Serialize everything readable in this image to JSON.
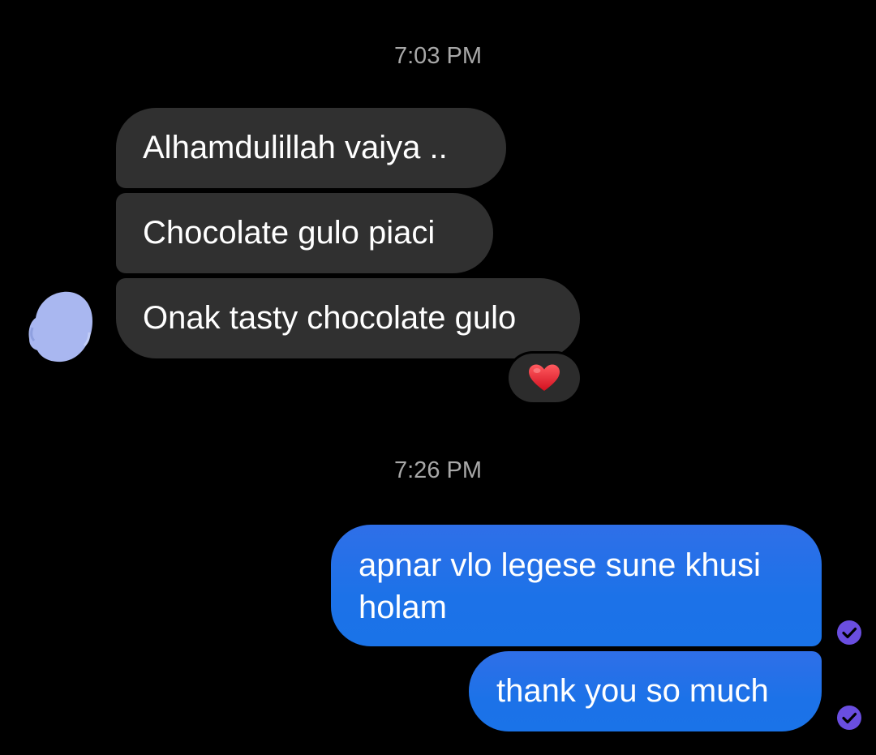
{
  "conversation": {
    "timestamps": [
      "7:03 PM",
      "7:26 PM"
    ],
    "incoming": [
      {
        "text": "Alhamdulillah vaiya .."
      },
      {
        "text": "Chocolate gulo piaci"
      },
      {
        "text": "Onak tasty chocolate gulo",
        "reaction": "heart-icon"
      }
    ],
    "outgoing": [
      {
        "text": "apnar vlo legese sune khusi holam",
        "status": "seen-check-icon"
      },
      {
        "text": "thank you so much",
        "status": "seen-check-icon"
      }
    ]
  },
  "colors": {
    "background": "#000000",
    "incoming_bubble": "#303030",
    "outgoing_bubble": "#1a73e8",
    "timestamp_text": "#a8a8a8",
    "seen_indicator": "#6a4ee0",
    "reaction_heart": "#e0202f",
    "avatar_blur": "#a9b7f0"
  }
}
